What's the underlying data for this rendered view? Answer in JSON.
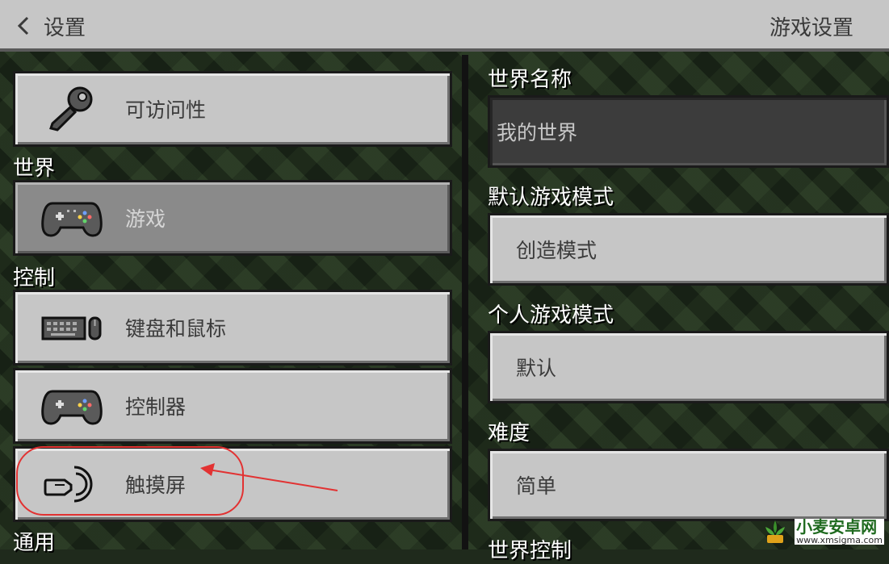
{
  "header": {
    "back_label": "设置",
    "page_title": "游戏设置"
  },
  "sidebar": {
    "items": [
      {
        "label": "可访问性",
        "icon": "key-icon"
      },
      {
        "label": "游戏",
        "icon": "gamepad-icon",
        "selected": true
      },
      {
        "label": "键盘和鼠标",
        "icon": "keyboard-mouse-icon"
      },
      {
        "label": "控制器",
        "icon": "controller-icon"
      },
      {
        "label": "触摸屏",
        "icon": "touch-hand-icon"
      }
    ],
    "sections": {
      "world": "世界",
      "controls": "控制",
      "general": "通用"
    }
  },
  "settings": {
    "world_name_label": "世界名称",
    "world_name_value": "我的世界",
    "default_mode_label": "默认游戏模式",
    "default_mode_value": "创造模式",
    "personal_mode_label": "个人游戏模式",
    "personal_mode_value": "默认",
    "difficulty_label": "难度",
    "difficulty_value": "简单",
    "next_label_partial": "世界控制"
  },
  "colors": {
    "panel": "#c6c6c6",
    "selected": "#8a8a8a",
    "annotation": "#e23232"
  },
  "watermark": {
    "title": "小麦安卓网",
    "url": "www.xmsigma.com"
  }
}
